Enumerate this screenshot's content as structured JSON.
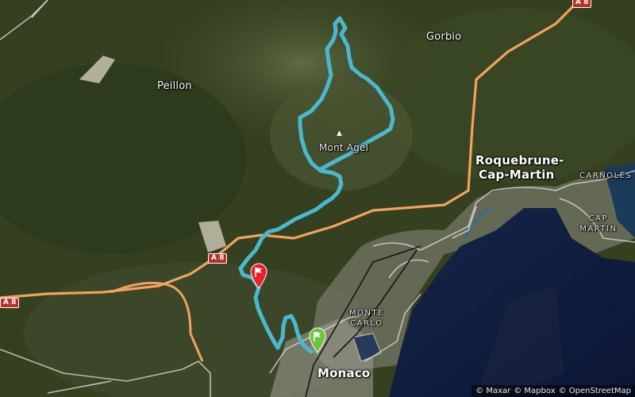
{
  "map": {
    "labels": {
      "peillon": "Peillon",
      "gorbio": "Gorbio",
      "mont_agel": "Mont Agel",
      "roquebrune": "Roquebrune-",
      "cap_martin_town": "Cap-Martin",
      "carnoles": "CARNOLÈS",
      "cap_martin_area_1": "CAP",
      "cap_martin_area_2": "MARTIN",
      "monte_carlo_1": "MONTE",
      "monte_carlo_2": "CARLO",
      "monaco": "Monaco"
    },
    "road_shields": [
      "A 8",
      "A 8",
      "A 8"
    ],
    "attribution": [
      "© Maxar",
      "© Mapbox",
      "© OpenStreetMap"
    ],
    "colors": {
      "route": "#4ab8cf",
      "motorway": "#f2a25c",
      "start_marker": "#e8202a",
      "end_marker": "#6fc33c",
      "sea": "#0f1d3a"
    },
    "markers": {
      "start": "red-flag-marker",
      "end": "green-flag-marker",
      "peak": "peak-icon"
    }
  }
}
